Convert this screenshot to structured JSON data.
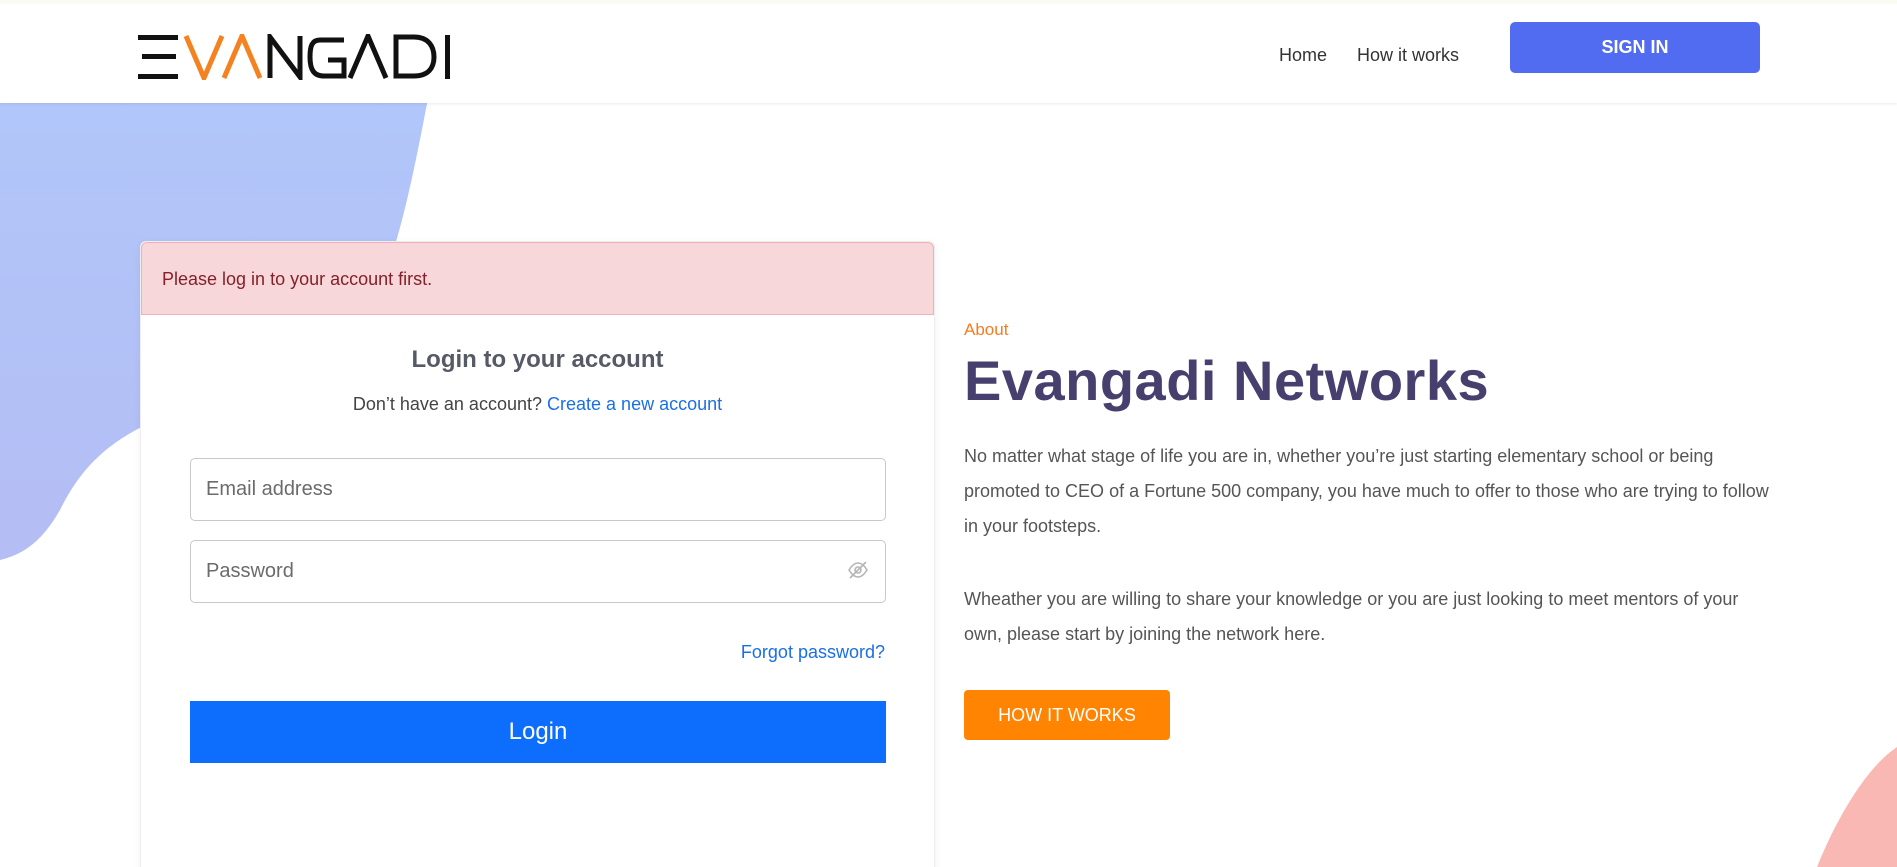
{
  "header": {
    "brand": "EVANGADI",
    "nav": [
      "Home",
      "How it works"
    ],
    "signin_label": "SIGN IN"
  },
  "alert": {
    "message": "Please log in to your account first."
  },
  "login": {
    "title": "Login to your account",
    "no_account_text": "Don’t have an account?",
    "create_account_link": "Create a new account",
    "email_placeholder": "Email address",
    "password_placeholder": "Password",
    "forgot_password": "Forgot password?",
    "login_button": "Login"
  },
  "about": {
    "kicker": "About",
    "title": "Evangadi Networks",
    "paragraph1": "No matter what stage of life you are in, whether you’re just starting elementary school or being promoted to CEO of a Fortune 500 company, you have much to offer to those who are trying to follow in your footsteps.",
    "paragraph2": "Wheather you are willing to share your knowledge or you are just looking to meet mentors of your own, please start by joining the network here.",
    "button": "HOW IT WORKS"
  },
  "colors": {
    "primary_blue": "#0d6efd",
    "signin_blue": "#516cf0",
    "accent_orange": "#fe8402",
    "title_purple": "#473f6e",
    "alert_bg": "#f8d7da"
  }
}
